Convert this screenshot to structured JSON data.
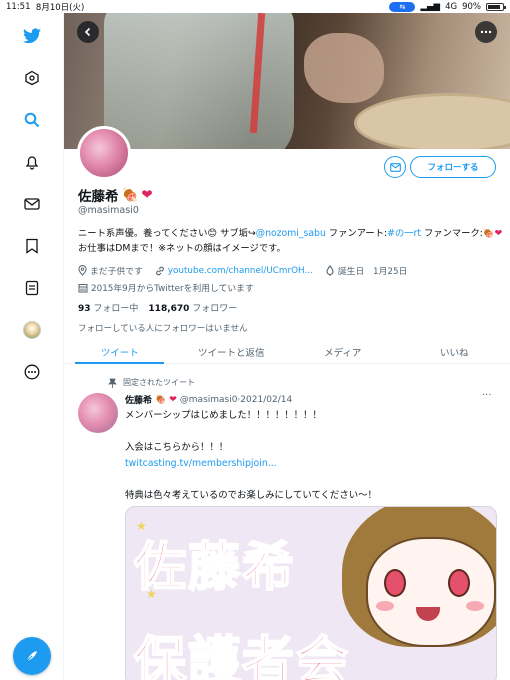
{
  "status_bar": {
    "time": "11:51",
    "date": "8月10日(火)",
    "network": "4G",
    "battery": "90%"
  },
  "profile": {
    "display_name": "佐藤希",
    "handle": "@masimasi0",
    "follow_label": "フォローする",
    "bio": {
      "t1": "ニート系声優。養ってください",
      "t2": " サブ垢↪",
      "sub_account": "@nozomi_sabu",
      "t3": " ファンアート:",
      "fanart_tag": "#の一rt",
      "t4": " ファンマーク:",
      "t5": " お仕事はDMまで！※ネットの顔はイメージです。"
    },
    "location": "まだ子供です",
    "link": "youtube.com/channel/UCmrOH...",
    "birthday": "誕生日　1月25日",
    "joined": "2015年9月からTwitterを利用しています",
    "following_count": "93",
    "following_label": "フォロー中",
    "followers_count": "118,670",
    "followers_label": "フォロワー",
    "no_mutual": "フォローしている人にフォロワーはいません"
  },
  "tabs": [
    {
      "label": "ツイート"
    },
    {
      "label": "ツイートと返信"
    },
    {
      "label": "メディア"
    },
    {
      "label": "いいね"
    }
  ],
  "pinned_tweet": {
    "pinned_label": "固定されたツイート",
    "author": "佐藤希",
    "meta": "@masimasi0·2021/02/14",
    "lines": [
      "メンバーシップはじめました！！！！！！！！",
      "入会はこちらから！！！",
      "twitcasting.tv/membershipjoin...",
      "特典は色々考えているのでお楽しみにしていてください〜！"
    ],
    "media_text_1": "佐藤希",
    "media_text_2": "保護者会"
  },
  "icons": [
    "twitter-logo-icon",
    "explore-icon",
    "search-icon",
    "bell-icon",
    "mail-icon",
    "bookmark-icon",
    "list-icon",
    "profile-icon",
    "more-icon",
    "compose-icon",
    "back-icon",
    "more-dots-icon",
    "pin-icon",
    "location-icon",
    "link-icon",
    "birthday-icon",
    "calendar-icon"
  ],
  "colors": {
    "accent": "#1d9bf0",
    "text": "#0f1419",
    "muted": "#536471",
    "heart": "#e0245e"
  }
}
